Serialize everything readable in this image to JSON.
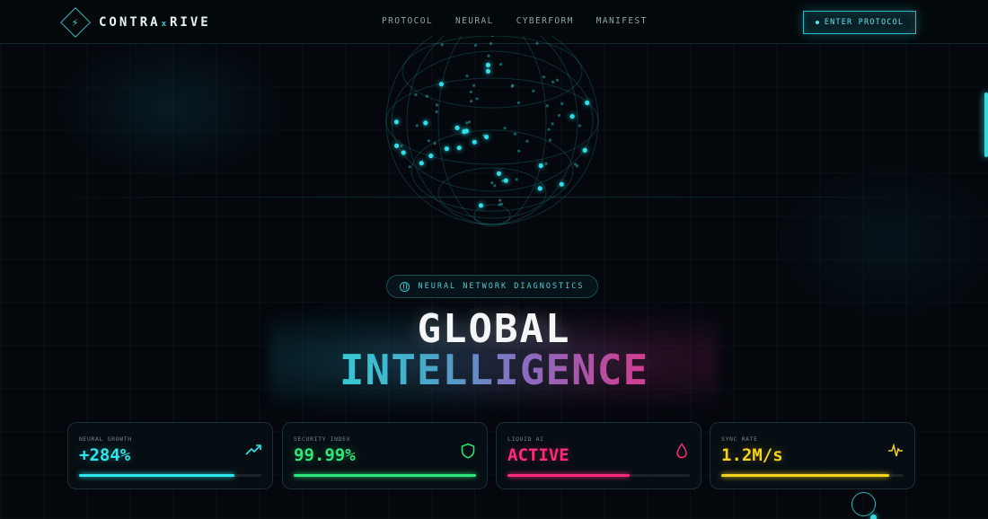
{
  "nav": {
    "brand_left": "CONTRA",
    "brand_x": "x",
    "brand_right": "RIVE",
    "links": [
      {
        "label": "PROTOCOL"
      },
      {
        "label": "NEURAL"
      },
      {
        "label": "CYBERFORM"
      },
      {
        "label": "MANIFEST"
      }
    ],
    "cta_label": "ENTER PROTOCOL"
  },
  "badge": {
    "icon": "globe-icon",
    "label": "NEURAL NETWORK DIAGNOSTICS"
  },
  "hero": {
    "line1": "GLOBAL",
    "line2": "INTELLIGENCE"
  },
  "stats": [
    {
      "label": "NEURAL GROWTH",
      "value": "+284%",
      "icon": "trending-up-icon",
      "color": "#2ee6ee",
      "progress": 0.85
    },
    {
      "label": "SECURITY INDEX",
      "value": "99.99%",
      "icon": "shield-icon",
      "color": "#2ee67a",
      "progress": 1.0
    },
    {
      "label": "LIQUID AI",
      "value": "ACTIVE",
      "icon": "droplet-icon",
      "color": "#ff2a78",
      "progress": 0.67
    },
    {
      "label": "SYNC RATE",
      "value": "1.2M/s",
      "icon": "pulse-icon",
      "color": "#f5d21e",
      "progress": 0.92
    }
  ],
  "colors": {
    "accent": "#2fb9c4",
    "background": "#04080d"
  }
}
